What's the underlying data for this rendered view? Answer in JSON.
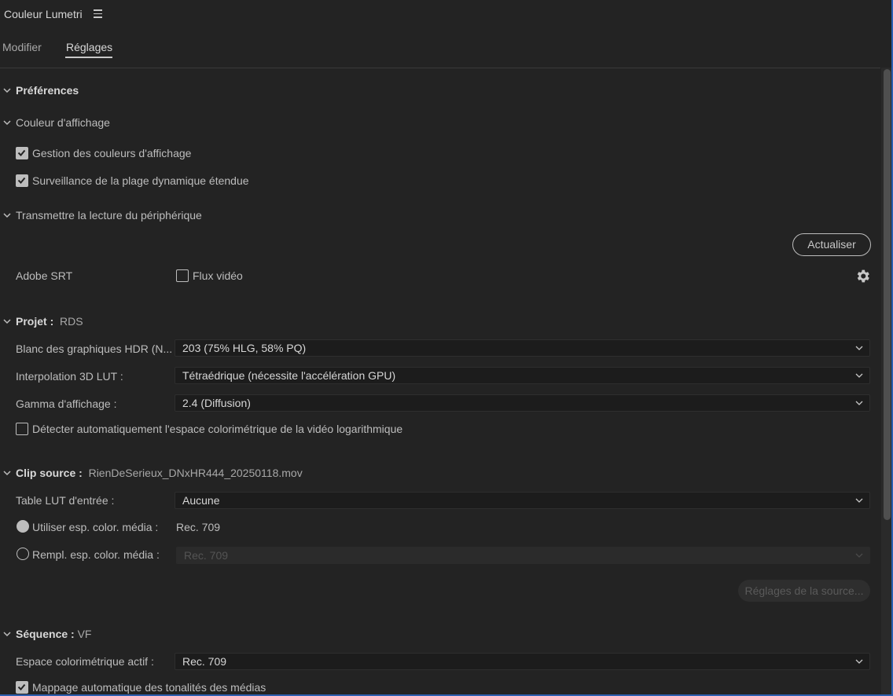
{
  "panel": {
    "title": "Couleur Lumetri"
  },
  "tabs": [
    {
      "label": "Modifier",
      "active": false
    },
    {
      "label": "Réglages",
      "active": true
    }
  ],
  "preferences": {
    "header": "Préférences",
    "display_color": {
      "header": "Couleur d'affichage",
      "manage_colors": {
        "label": "Gestion des couleurs d'affichage",
        "checked": true
      },
      "hdr_monitoring": {
        "label": "Surveillance de la plage dynamique étendue",
        "checked": true
      }
    },
    "device_playback": {
      "header": "Transmettre la lecture du périphérique",
      "refresh_button": "Actualiser",
      "adobe_srt_label": "Adobe SRT",
      "video_stream": {
        "label": "Flux vidéo",
        "checked": false
      }
    }
  },
  "project": {
    "header": "Projet :",
    "name": "RDS",
    "hdr_white": {
      "label": "Blanc des graphiques HDR (N...",
      "value": "203 (75% HLG, 58% PQ)"
    },
    "lut_interp": {
      "label": "Interpolation 3D LUT :",
      "value": "Tétraédrique (nécessite l'accélération GPU)"
    },
    "display_gamma": {
      "label": "Gamma d'affichage :",
      "value": "2.4 (Diffusion)"
    },
    "auto_detect": {
      "label": "Détecter automatiquement l'espace colorimétrique de la vidéo logarithmique",
      "checked": false
    }
  },
  "source_clip": {
    "header": "Clip source :",
    "name": "RienDeSerieux_DNxHR444_20250118.mov",
    "input_lut": {
      "label": "Table LUT d'entrée :",
      "value": "Aucune"
    },
    "use_media_space": {
      "label": "Utiliser esp. color. média :",
      "value": "Rec. 709",
      "selected": true
    },
    "override_media_space": {
      "label": "Rempl. esp. color. média :",
      "value": "Rec. 709",
      "selected": false
    },
    "source_settings_button": "Réglages de la source..."
  },
  "sequence": {
    "header": "Séquence :",
    "name": "VF",
    "working_space": {
      "label": "Espace colorimétrique actif :",
      "value": "Rec. 709"
    },
    "auto_tonemap": {
      "label": "Mappage automatique des tonalités des médias",
      "checked": true
    }
  },
  "colors": {
    "background": "#232323",
    "text": "#bdbdbd",
    "dropdown_bg": "#1c1c1c",
    "accent_edge": "#2d5fb0"
  },
  "icons": {
    "menu": "hamburger-icon",
    "collapse": "chevron-down-icon",
    "settings": "gear-icon",
    "check": "checkmark-icon"
  }
}
